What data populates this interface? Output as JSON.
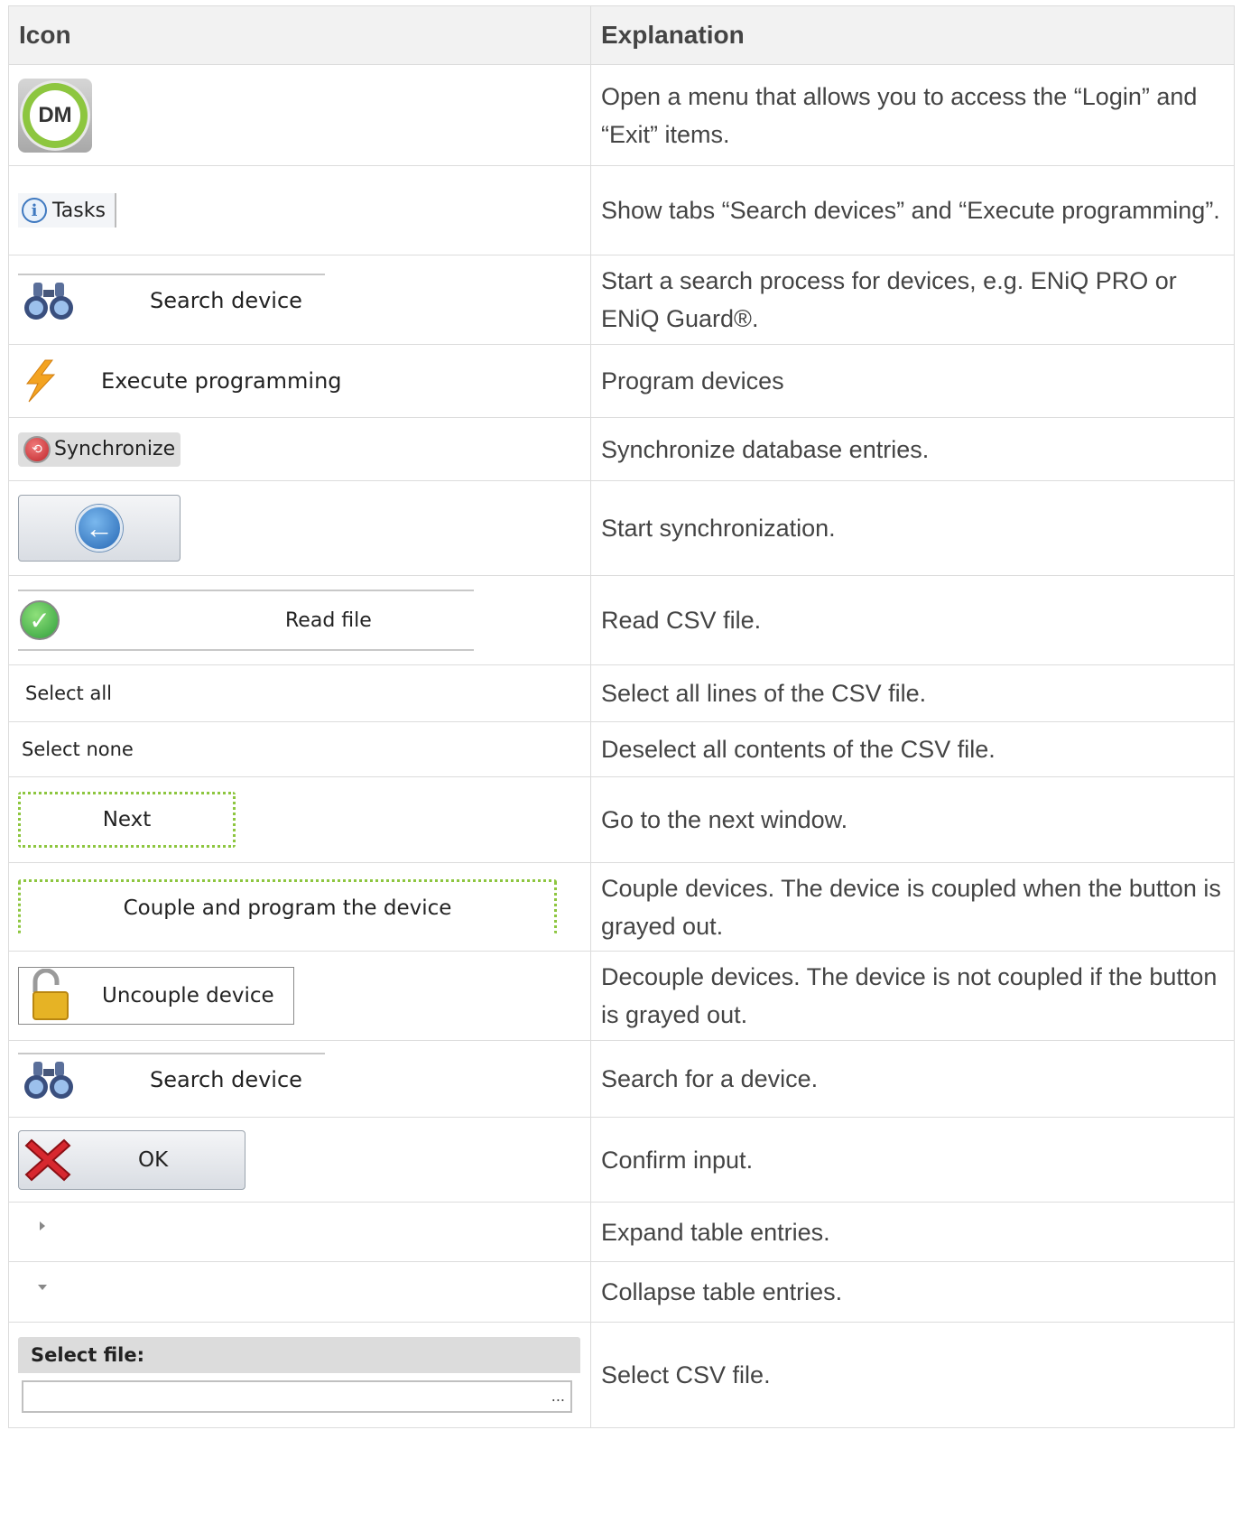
{
  "header": {
    "icon": "Icon",
    "explanation": "Explanation"
  },
  "rows": [
    {
      "icon": "dm-logo-icon",
      "ui_label": "DM",
      "explanation": "Open a menu that allows you to access the “Login” and “Exit” items."
    },
    {
      "icon": "info-icon",
      "ui_label": "Tasks",
      "explanation": "Show tabs “Search devices” and “Execute programming”."
    },
    {
      "icon": "binoculars-icon",
      "ui_label": "Search device",
      "explanation": "Start a search process for devices, e.g. ENiQ PRO or ENiQ Guard®."
    },
    {
      "icon": "lightning-icon",
      "ui_label": "Execute programming",
      "explanation": "Program devices"
    },
    {
      "icon": "sync-icon",
      "ui_label": "Synchronize",
      "explanation": "Synchronize database entries."
    },
    {
      "icon": "back-arrow-icon",
      "ui_label": "",
      "explanation": "Start synchronization."
    },
    {
      "icon": "checkmark-icon",
      "ui_label": "Read file",
      "explanation": "Read CSV file."
    },
    {
      "icon": "",
      "ui_label": "Select all",
      "explanation": "Select all lines of the CSV file."
    },
    {
      "icon": "",
      "ui_label": "Select none",
      "explanation": "Deselect all contents of the CSV file."
    },
    {
      "icon": "",
      "ui_label": "Next",
      "explanation": "Go to the next window."
    },
    {
      "icon": "",
      "ui_label": "Couple and program the device",
      "explanation": "Couple devices. The device is coupled when the button is grayed out."
    },
    {
      "icon": "padlock-open-icon",
      "ui_label": "Uncouple device",
      "explanation": "Decouple devices. The device is not coupled if the button is grayed out."
    },
    {
      "icon": "binoculars-icon",
      "ui_label": "Search device",
      "explanation": "Search for a device."
    },
    {
      "icon": "red-x-icon",
      "ui_label": "OK",
      "explanation": "Confirm input."
    },
    {
      "icon": "triangle-right-icon",
      "ui_label": "",
      "explanation": "Expand table entries."
    },
    {
      "icon": "triangle-down-icon",
      "ui_label": "",
      "explanation": "Collapse table entries."
    },
    {
      "icon": "ellipsis-icon",
      "ui_label": "Select file:",
      "ui_button": "...",
      "explanation": "Select CSV file."
    }
  ],
  "colors": {
    "accent_green": "#8dc63f",
    "header_bg": "#f2f2f2",
    "border": "#dcdcdc",
    "text": "#444444"
  }
}
